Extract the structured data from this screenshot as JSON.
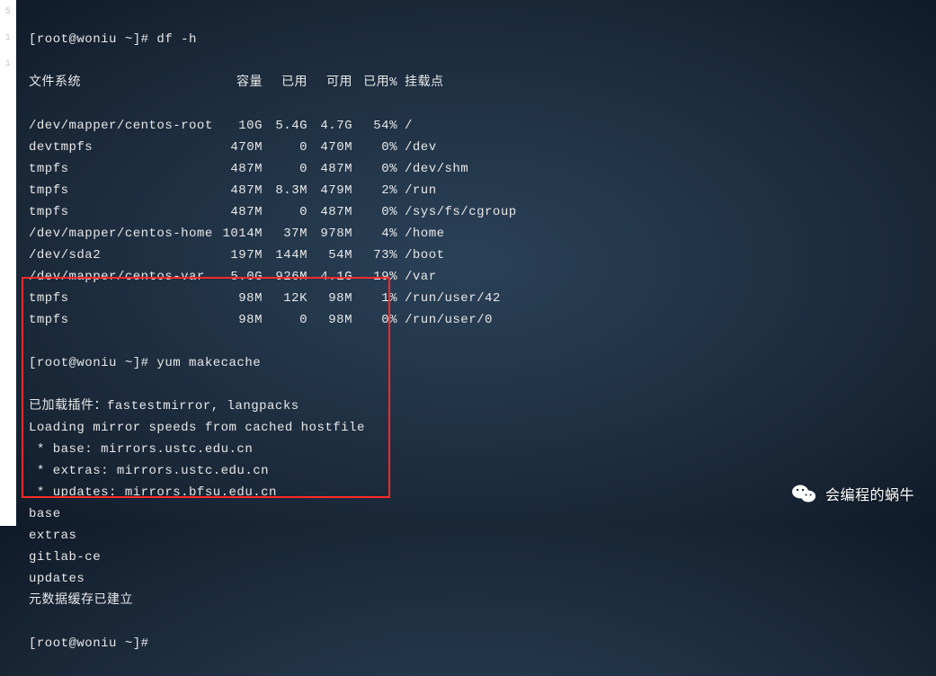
{
  "prompt1": "[root@woniu ~]# df -h",
  "headers": {
    "fs": "文件系统",
    "size": "容量",
    "used": "已用",
    "avail": "可用",
    "pct": "已用%",
    "mnt": "挂载点"
  },
  "rows": [
    {
      "fs": "/dev/mapper/centos-root",
      "size": "10G",
      "used": "5.4G",
      "avail": "4.7G",
      "pct": "54%",
      "mnt": "/"
    },
    {
      "fs": "devtmpfs",
      "size": "470M",
      "used": "0",
      "avail": "470M",
      "pct": "0%",
      "mnt": "/dev"
    },
    {
      "fs": "tmpfs",
      "size": "487M",
      "used": "0",
      "avail": "487M",
      "pct": "0%",
      "mnt": "/dev/shm"
    },
    {
      "fs": "tmpfs",
      "size": "487M",
      "used": "8.3M",
      "avail": "479M",
      "pct": "2%",
      "mnt": "/run"
    },
    {
      "fs": "tmpfs",
      "size": "487M",
      "used": "0",
      "avail": "487M",
      "pct": "0%",
      "mnt": "/sys/fs/cgroup"
    },
    {
      "fs": "/dev/mapper/centos-home",
      "size": "1014M",
      "used": "37M",
      "avail": "978M",
      "pct": "4%",
      "mnt": "/home"
    },
    {
      "fs": "/dev/sda2",
      "size": "197M",
      "used": "144M",
      "avail": "54M",
      "pct": "73%",
      "mnt": "/boot"
    },
    {
      "fs": "/dev/mapper/centos-var",
      "size": "5.0G",
      "used": "926M",
      "avail": "4.1G",
      "pct": "19%",
      "mnt": "/var"
    },
    {
      "fs": "tmpfs",
      "size": "98M",
      "used": "12K",
      "avail": "98M",
      "pct": "1%",
      "mnt": "/run/user/42"
    },
    {
      "fs": "tmpfs",
      "size": "98M",
      "used": "0",
      "avail": "98M",
      "pct": "0%",
      "mnt": "/run/user/0"
    }
  ],
  "prompt2": "[root@woniu ~]# yum makecache",
  "boxed_lines": [
    "已加载插件：fastestmirror, langpacks",
    "Loading mirror speeds from cached hostfile",
    " * base: mirrors.ustc.edu.cn",
    " * extras: mirrors.ustc.edu.cn",
    " * updates: mirrors.bfsu.edu.cn",
    "base",
    "extras",
    "gitlab-ce",
    "updates",
    "元数据缓存已建立"
  ],
  "prompt3": "[root@woniu ~]#",
  "watermark_text": "会编程的蜗牛",
  "gutter": [
    "",
    "",
    "",
    "",
    "",
    "5",
    "1",
    "1"
  ]
}
